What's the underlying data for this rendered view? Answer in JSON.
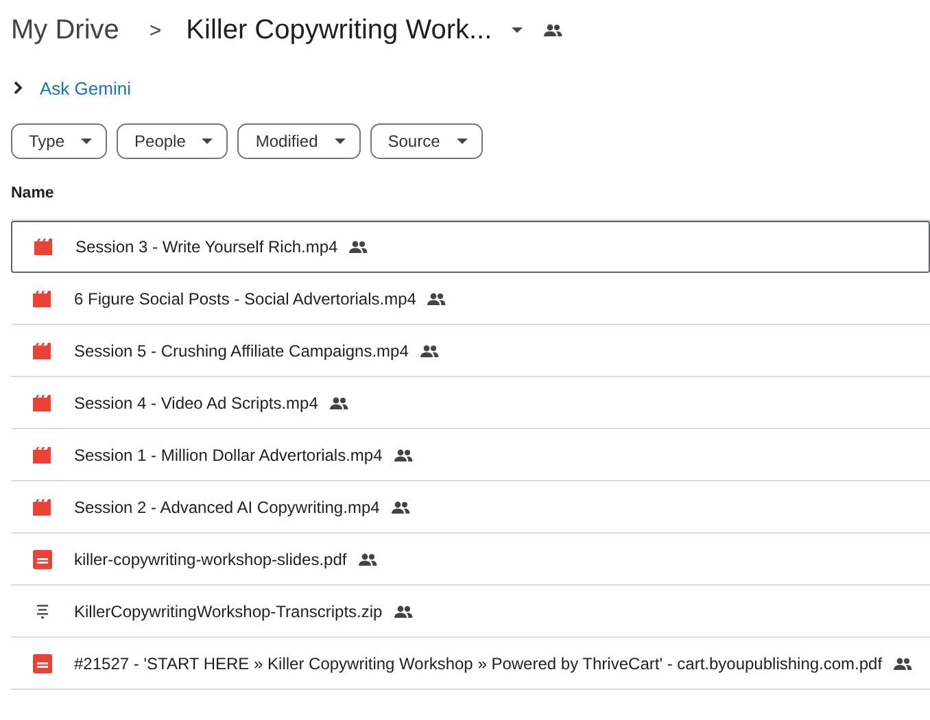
{
  "breadcrumb": {
    "root": "My Drive",
    "separator": ">",
    "folder": "Killer Copywriting Work...",
    "shared": true
  },
  "gemini": {
    "label": "Ask Gemini",
    "expanded": false
  },
  "filters": [
    {
      "label": "Type"
    },
    {
      "label": "People"
    },
    {
      "label": "Modified"
    },
    {
      "label": "Source"
    }
  ],
  "table": {
    "columns": [
      "Name"
    ],
    "rows": [
      {
        "name": "Session 3 - Write Yourself Rich.mp4",
        "kind": "video",
        "shared": true,
        "selected": true
      },
      {
        "name": "6 Figure Social Posts - Social Advertorials.mp4",
        "kind": "video",
        "shared": true,
        "selected": false
      },
      {
        "name": "Session 5 - Crushing Affiliate Campaigns.mp4",
        "kind": "video",
        "shared": true,
        "selected": false
      },
      {
        "name": "Session 4 - Video Ad Scripts.mp4",
        "kind": "video",
        "shared": true,
        "selected": false
      },
      {
        "name": "Session 1 - Million Dollar Advertorials.mp4",
        "kind": "video",
        "shared": true,
        "selected": false
      },
      {
        "name": "Session 2 - Advanced AI Copywriting.mp4",
        "kind": "video",
        "shared": true,
        "selected": false
      },
      {
        "name": "killer-copywriting-workshop-slides.pdf",
        "kind": "pdf",
        "shared": true,
        "selected": false
      },
      {
        "name": "KillerCopywritingWorkshop-Transcripts.zip",
        "kind": "zip",
        "shared": true,
        "selected": false
      },
      {
        "name": "#21527 - 'START HERE » Killer Copywriting Workshop » Powered by ThriveCart' - cart.byoupublishing.com.pdf",
        "kind": "pdf",
        "shared": true,
        "selected": false
      }
    ]
  }
}
